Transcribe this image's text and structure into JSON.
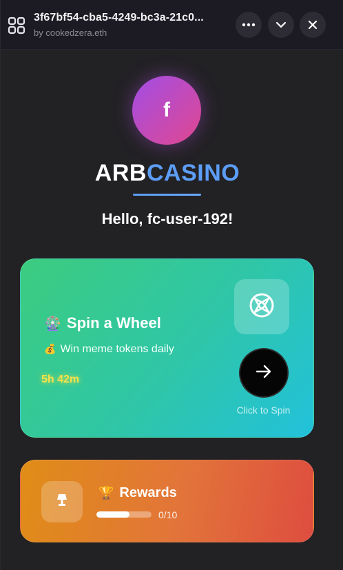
{
  "titlebar": {
    "app_title": "3f67bf54-cba5-4249-bc3a-21c0...",
    "author": "by cookedzera.eth",
    "apps_icon": "apps-grid-icon",
    "more_icon": "more-dots-icon",
    "collapse_icon": "chevron-down-icon",
    "close_icon": "close-icon"
  },
  "profile": {
    "avatar_letter": "f",
    "brand_part1": "ARB",
    "brand_part2": "CASINO",
    "greeting": "Hello, fc-user-192!"
  },
  "spin_card": {
    "emoji": "🎡",
    "title": "Spin a Wheel",
    "sub_emoji": "💰",
    "subtitle": "Win meme tokens daily",
    "timer": "5h 42m",
    "wheel_icon": "wheel-icon",
    "arrow_icon": "arrow-right-icon",
    "hint": "Click to Spin"
  },
  "rewards_card": {
    "icon": "lamp-icon",
    "emoji": "🏆",
    "title": "Rewards",
    "progress_fraction": 0.6,
    "progress_text": "0/10"
  },
  "colors": {
    "brand_accent": "#5c9df5",
    "spin_gradient_start": "#3ccc7f",
    "spin_gradient_end": "#22c1db",
    "rewards_gradient_start": "#e08d17",
    "rewards_gradient_end": "#de4d3f",
    "timer": "#f7e24a"
  }
}
